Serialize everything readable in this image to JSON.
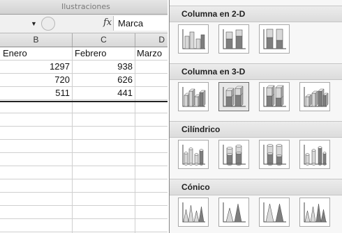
{
  "ribbon": {
    "group_label": "Ilustraciones"
  },
  "formula_bar": {
    "fx_label": "fx",
    "value": "Marca"
  },
  "sheet": {
    "column_headers": [
      "B",
      "C",
      "D"
    ],
    "header_row": [
      "Enero",
      "Febrero",
      "Marzo"
    ],
    "rows": [
      [
        "1297",
        "938"
      ],
      [
        "720",
        "626"
      ],
      [
        "511",
        "441"
      ]
    ]
  },
  "gallery": {
    "sections": [
      {
        "title": "Columna en 2-D",
        "icons": [
          "clustered-column-icon",
          "stacked-column-icon",
          "100-stacked-column-icon"
        ]
      },
      {
        "title": "Columna en 3-D",
        "icons": [
          "3d-clustered-column-icon",
          "3d-stacked-column-icon",
          "3d-100-stacked-column-icon",
          "3d-column-icon"
        ]
      },
      {
        "title": "Cilíndrico",
        "icons": [
          "clustered-cylinder-icon",
          "stacked-cylinder-icon",
          "100-stacked-cylinder-icon",
          "3d-cylinder-icon"
        ]
      },
      {
        "title": "Cónico",
        "icons": [
          "clustered-cone-icon",
          "stacked-cone-icon",
          "100-stacked-cone-icon",
          "3d-cone-icon"
        ]
      }
    ]
  },
  "colors": {
    "grid": "#cfcfcf",
    "gallery_bg": "#f7f7f7",
    "bar_light": "#d8d8d8",
    "bar_dark": "#7e7e7e"
  }
}
